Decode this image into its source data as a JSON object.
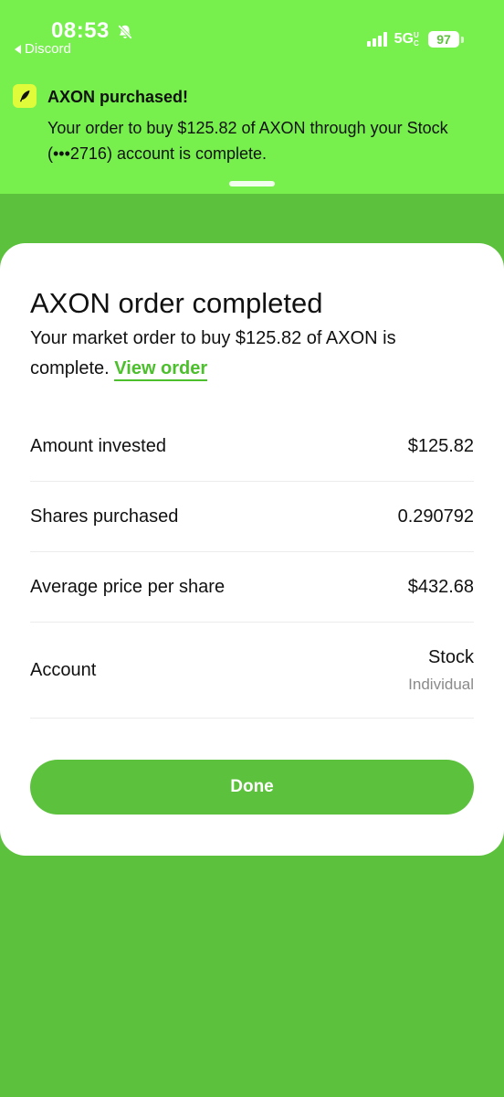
{
  "status_bar": {
    "time": "08:53",
    "back_app": "Discord",
    "network": "5G",
    "network_suffix": "UC",
    "battery": "97"
  },
  "notification": {
    "title": "AXON purchased!",
    "body": "Your order to buy $125.82 of AXON through your Stock (•••2716) account is complete."
  },
  "card": {
    "title": "AXON order completed",
    "description": "Your market order to buy $125.82 of AXON is complete.",
    "link": "View order",
    "rows": [
      {
        "label": "Amount invested",
        "value": "$125.82"
      },
      {
        "label": "Shares purchased",
        "value": "0.290792"
      },
      {
        "label": "Average price per share",
        "value": "$432.68"
      },
      {
        "label": "Account",
        "value": "Stock",
        "sub": "Individual"
      }
    ],
    "done_label": "Done"
  },
  "colors": {
    "banner": "#77f04e",
    "background": "#5cc23d",
    "accent": "#4cbf2c",
    "app_icon": "#dffb3a"
  },
  "icons": {
    "bell": "bell-slash-icon",
    "signal": "cellular-signal-icon",
    "battery": "battery-icon",
    "app": "robinhood-feather-icon",
    "back": "back-triangle-icon"
  }
}
